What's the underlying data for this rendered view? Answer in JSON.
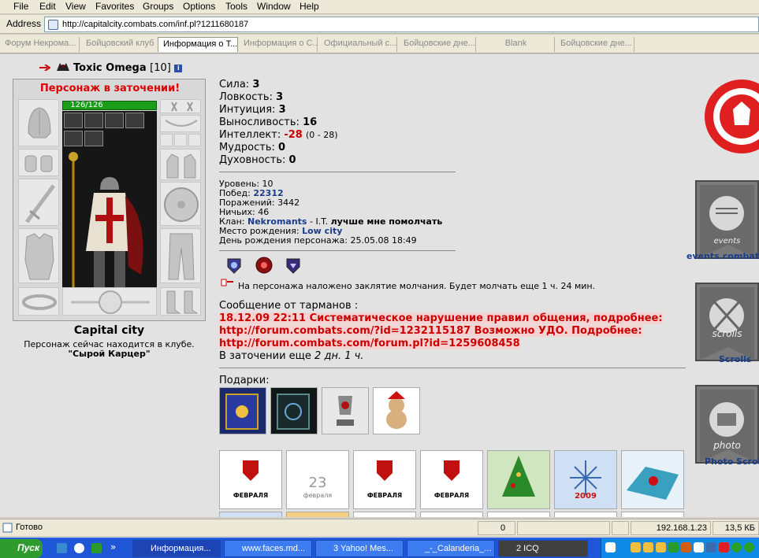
{
  "menu": [
    "File",
    "Edit",
    "View",
    "Favorites",
    "Groups",
    "Options",
    "Tools",
    "Window",
    "Help"
  ],
  "address": {
    "label": "Address",
    "url": "http://capitalcity.combats.com/inf.pl?1211680187"
  },
  "tabs": [
    "Форум Некрома...",
    "Бойцовский клуб",
    "Информация о Т...",
    "Информация о С...",
    "Официальный с...",
    "Бойцовские дне...",
    "Blank",
    "Бойцовские дне..."
  ],
  "profile": {
    "name": "Toxic Omega",
    "level": "[10]",
    "jail_label": "Персонаж в заточении!",
    "hp": "126/126",
    "city": "Capital city",
    "club_text": "Персонаж сейчас находится в клубе.",
    "club_name": "\"Сырой Карцер\""
  },
  "stats": {
    "strength_label": "Сила:",
    "strength": "3",
    "agility_label": "Ловкость:",
    "agility": "3",
    "intuition_label": "Интуиция:",
    "intuition": "3",
    "endurance_label": "Выносливость:",
    "endurance": "16",
    "intellect_label": "Интеллект:",
    "intellect": "-28",
    "intellect_range": "(0 - 28)",
    "wisdom_label": "Мудрость:",
    "wisdom": "0",
    "spirit_label": "Духовность:",
    "spirit": "0"
  },
  "info": {
    "level": "Уровень: 10",
    "wins_label": "Побед:",
    "wins": "22312",
    "losses": "Поражений: 3442",
    "draws": "Ничьих: 46",
    "clan_label": "Клан:",
    "clan": "Nekromants",
    "clan_rank": "- I.T.",
    "clan_motto": "лучше мне помолчать",
    "birthplace_label": "Место рождения:",
    "birthplace": "Low city",
    "birthday": "День рождения персонажа: 25.05.08 18:49"
  },
  "silence": "На персонажа наложено заклятие молчания. Будет молчать еще 1 ч. 24 мин.",
  "message": {
    "header": "Сообщение от тарманов :",
    "line1": "18.12.09 22:11 Систематическое нарушение правил общения, подробнее:",
    "line2": "http://forum.combats.com/?id=1232115187 Возможно УДО. Подробнее:",
    "line3": "http://forum.combats.com/forum.pl?id=1259608458",
    "jail_time_label": "В заточении еще",
    "jail_time": "2 дн. 1 ч."
  },
  "gifts_label": "Подарки:",
  "card_texts": {
    "feb": "ФЕВРАЛЯ",
    "feb23": "23",
    "feb_lower": "февраля",
    "year": "2009"
  },
  "banners": [
    "events.combats",
    "Scrolls",
    "Photo Scroll"
  ],
  "banner_inner": [
    "events",
    "scrolls",
    "photo"
  ],
  "status": {
    "text": "Готово",
    "count": "0",
    "ip": "192.168.1.23",
    "size": "13,5 КБ"
  },
  "taskbar": {
    "start": "Пуск",
    "tasks": [
      "Информация...",
      "www.faces.md...",
      "3 Yahoo! Mes...",
      "_-_Calanderia_...",
      "2 ICQ"
    ]
  },
  "colors": {
    "jail_red": "#dd0000",
    "link_blue": "#1a3c8a",
    "hp_green": "#1a9e1a",
    "taskbar_blue": "#1f56d8"
  }
}
